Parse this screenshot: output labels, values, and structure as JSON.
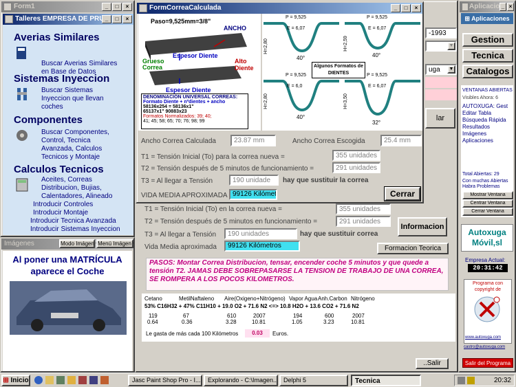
{
  "form1": {
    "title": "Form1",
    "header": "Talleres EMPRESA DE PRUE",
    "sections": [
      {
        "heading": "Averias Similares",
        "links": [
          "Buscar Averias Similares",
          "en Base de Datos"
        ]
      },
      {
        "heading": "Sistemas Inyeccion",
        "links": [
          "Buscar Sistemas",
          "Inyeccion que llevan",
          "coches"
        ]
      },
      {
        "heading": "Componentes",
        "links": [
          "Buscar Componentes,",
          "Control,  Tecnica",
          "Avanzada,  Calculos",
          "Tecnicos y Montaje"
        ]
      },
      {
        "heading": "Calculos Tecnicos",
        "links": [
          "Aceites, Correas",
          "Distribucion,  Bujias,",
          "Calentadores, Alineado"
        ]
      }
    ],
    "extra_links": [
      "Introducir Controles",
      "Introducir Montaje",
      "Introducir Tecnica Avanzada",
      "Introducir Sistemas Inyeccion"
    ]
  },
  "imagenes": {
    "title": "Imágenes",
    "mode_label": "Modo Imágen",
    "menu_label": "Menú Imágen",
    "caption": "Al poner una MATRÍCULA aparece el Coche"
  },
  "correa": {
    "title": "FormCorreaCalculada",
    "diagram": {
      "paso": "Paso=9,525mm=3/8\"",
      "ancho": "ANCHO",
      "espesor1": "Espesor Diente",
      "grueso": "Grueso",
      "correa": "Correa",
      "alto": "Alto",
      "diente": "Diente",
      "espesor2": "Espesor Diente",
      "denom_title": "DENOMINACIÓN UNIVERSAL CORREAS:",
      "denom_formula": "Formato Diente + nºdientes + ancho",
      "ex1": "58136x254 = 58136x1\"",
      "ex2": "65137x1\"    90883x23",
      "norm_label": "Formatos Normalizados: 39; 40;",
      "norm_values": "41; 45; 58; 65; 70; 76; 98; 99"
    },
    "profiles": [
      {
        "p": "P = 9,525",
        "e": "E = 6,07",
        "h": "H=2,80",
        "angle": "40°"
      },
      {
        "p": "P = 9,525",
        "e": "E = 6,07",
        "h": "H=2,59",
        "angle": "40°"
      },
      {
        "p": "P = 9,525",
        "e": "E = 6,0",
        "h": "H=2,80",
        "angle": "40°"
      },
      {
        "p": "P = 9,525",
        "e": "E = 6,07",
        "h": "H=3,50",
        "angle": "32°"
      }
    ],
    "formatos_label": "Algunos Formatos de DIENTES",
    "ancho_calc_label": "Ancho Correa Calculada",
    "ancho_calc_value": "23.87 mm",
    "ancho_esc_label": "Ancho Correa Escogida",
    "ancho_esc_value": "25.4 mm",
    "t1_label": "T1 = Tensión Inicial (To) para la correa nueva =",
    "t1_value": "355 unidades",
    "t2_label": "T2 = Tensión después de 5 minutos de funcionamiento =",
    "t2_value": "291 unidades",
    "t3_label": "T3 = Al llegar a Tensión",
    "t3_value": "190 unidade",
    "t3_suffix": "hay que sustituir la correa",
    "vida_label": "VIDA MEDIA APROXIMADA",
    "vida_value": "99126 Kilómet",
    "close": "Cerrar"
  },
  "tecnica": {
    "title": "Tecnica",
    "date": "-1993",
    "dd_text": "uga",
    "btn_side": "lar",
    "t1_label": "T1 = Tensión Inicial (To) en la correa nueva =",
    "t1_value": "355 unidades",
    "t2_label": "T2 = Tensión después de 5 minutos en funcionamiento =",
    "t2_value": "291 unidades",
    "t3_label": "T3 = Al llegar a Tensión",
    "t3_value": "190 unidades",
    "t3_suffix": "hay que sustituir correa",
    "vida_label": "Vida Media aproximada",
    "vida_value": "99126 Kilómetros",
    "info_btn": "Informacion",
    "formacion_btn": "Formacion Teorica",
    "pasos": "PASOS: Montar Correa Distribucion, tensar, encender coche 5 minutos y que quede a tensión T2. JAMAS DEBE SOBREPASARSE LA TENSION DE TRABAJO DE UNA CORREA, SE ROMPERA A LOS POCOS KILOMETROS.",
    "chem_headers": [
      "Cetano",
      "MetilNaftaleno",
      "Aire(Oxigeno+Nitrógeno)",
      "Vapor Agua",
      "Anh.Carbon",
      "Nitrógeno"
    ],
    "chem_formula": "53% C16H32 + 47% C11H10 + 19.0 O2 + 71.6 N2  <=>  10.8 H2O + 13.6 CO2 + 71.6 N2",
    "row1": [
      "119",
      "67",
      "610",
      "2007",
      "194",
      "600",
      "2007"
    ],
    "row2": [
      "0.64",
      "0.36",
      "3.28",
      "10.81",
      "1.05",
      "3.23",
      "10.81"
    ],
    "gasta_label": "Le gasta de más cada 100 Kilómetros",
    "gasta_value": "0.03",
    "gasta_unit": "Euros.",
    "salir": "Salir"
  },
  "aplicaciones": {
    "title": "Aplicacione",
    "app_btn": "Aplicaciones",
    "gestion": "Gestion",
    "tecnica": "Tecnica",
    "catalogos": "Catalogos",
    "ventanas_label": "VENTANAS ABIERTAS",
    "visibles": "Visibles Ahora: 6",
    "list": [
      "AUTOXUGA: Gest",
      "Editar Tabla",
      "Búsqueda Rápida",
      "Resultados",
      "Imágenes",
      "Aplicaciones"
    ],
    "total": "Total Abiertas: 29",
    "problemas": "Con muchas Abiertas Habra Problemas",
    "mostrar": "Mostrar Ventana",
    "centrar": "Centrar Ventana",
    "cerrar": "Cerrar Ventana",
    "logo_line1": "Autoxuga",
    "logo_line2": "Móvil,sl",
    "empresa": "Empresa Actual:",
    "clock": "20:31:42",
    "copyright": "Programa con copyright de",
    "url1": "www.autoxuga.com",
    "url2": "castro@autoxuga.com",
    "salir": "Salir del Programa"
  },
  "taskbar": {
    "start": "Inicio",
    "tasks": [
      "Jasc Paint Shop Pro - I...",
      "Explorando - C:\\Imagen...",
      "Delphi 5",
      "Tecnica"
    ],
    "time": "20:32"
  }
}
